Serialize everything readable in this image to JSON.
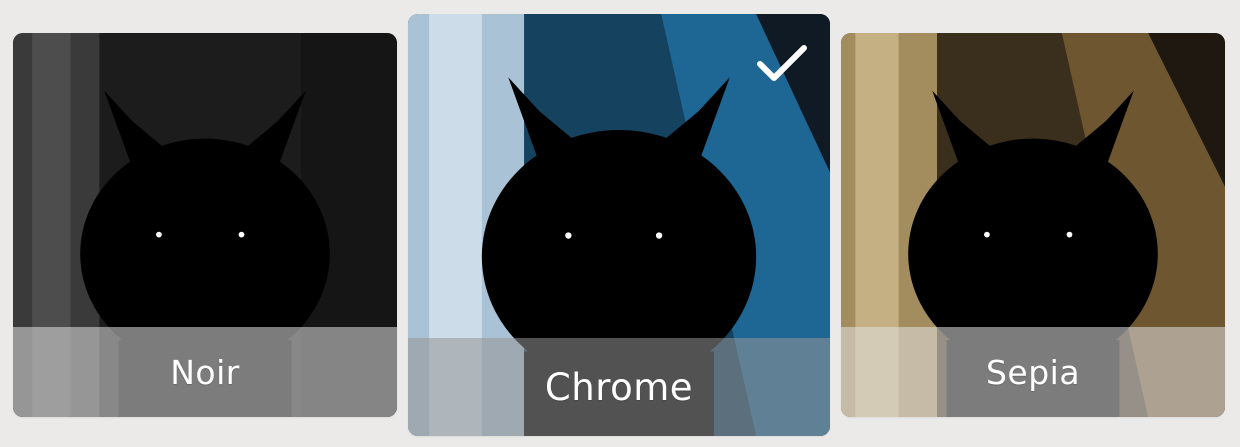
{
  "filters": [
    {
      "id": "noir",
      "label": "Noir",
      "selected": false
    },
    {
      "id": "chrome",
      "label": "Chrome",
      "selected": true
    },
    {
      "id": "sepia",
      "label": "Sepia",
      "selected": false
    }
  ],
  "selected_indicator_icon": "checkmark-icon",
  "colors": {
    "page_background": "#ebeae8",
    "label_text": "#ffffff",
    "noir_tint": "#2a2a2a",
    "chrome_tint": "#1f5a84",
    "sepia_tint": "#b8944f"
  }
}
